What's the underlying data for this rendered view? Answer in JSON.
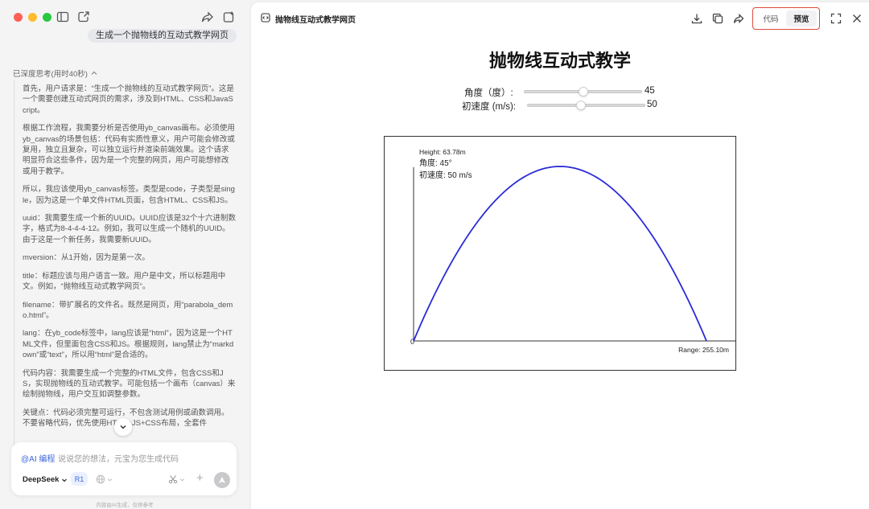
{
  "left_panel": {
    "window_controls": [
      "close",
      "minimize",
      "zoom"
    ],
    "colors": {
      "close": "#ff5f57",
      "minimize": "#febc2e",
      "zoom": "#28c840"
    },
    "toolbar_icons": [
      "sidebar-icon",
      "new-chat-icon",
      "share-icon",
      "new-window-icon"
    ],
    "user_message": "生成一个抛物线的互动式教学网页",
    "thinking_header": "已深度思考(用时40秒)",
    "thinking_paragraphs": [
      "首先，用户请求是：“生成一个抛物线的互动式教学网页”。这是一个需要创建互动式网页的需求，涉及到HTML、CSS和JavaScript。",
      "根据工作流程，我需要分析是否使用yb_canvas画布。必须使用yb_canvas的场景包括：代码有实质性意义，用户可能会修改或复用，独立且复杂，可以独立运行并渲染前端效果。这个请求明显符合这些条件，因为是一个完整的网页，用户可能想修改或用于教学。",
      "所以，我应该使用yb_canvas标签。类型是code，子类型是single，因为这是一个单文件HTML页面，包含HTML、CSS和JS。",
      "uuid：我需要生成一个新的UUID。UUID应该是32个十六进制数字，格式为8-4-4-4-12。例如，我可以生成一个随机的UUID。由于这是一个新任务，我需要新UUID。",
      "mversion：从1开始，因为是第一次。",
      "title：标题应该与用户语言一致。用户是中文，所以标题用中文。例如，“抛物线互动式教学网页”。",
      "filename：带扩展名的文件名。既然是网页，用“parabola_demo.html”。",
      "lang：在yb_code标签中，lang应该是“html”，因为这是一个HTML文件，但里面包含CSS和JS。根据规则，lang禁止为“markdown”或“text”，所以用“html”是合适的。",
      "代码内容：我需要生成一个完整的HTML文件，包含CSS和JS，实现抛物线的互动式教学。可能包括一个画布（canvas）来绘制抛物线，用户交互如调整参数。",
      "关键点：代码必须完整可运行，不包含测试用例或函数调用。不要省略代码，优先使用HTML+JS+CSS布局，全套件"
    ],
    "composer": {
      "tag": "@AI 编程",
      "placeholder": "说说您的想法，元宝为您生成代码",
      "model": "DeepSeek",
      "mode_badge": "R1"
    },
    "disclaimer": "内容由AI生成，仅供参考"
  },
  "right_panel": {
    "document_title": "抛物线互动式教学网页",
    "header_icons": [
      "download-icon",
      "copy-icon",
      "share-icon",
      "fullscreen-icon",
      "close-icon"
    ],
    "tabs": [
      {
        "label": "代码",
        "active": false
      },
      {
        "label": "预览",
        "active": true
      }
    ],
    "accent_color": "#e04a3b",
    "preview": {
      "heading": "抛物线互动式教学",
      "angle_label": "角度（度）:",
      "angle_value": "45",
      "angle_fraction": 0.5,
      "speed_label": "初速度 (m/s):",
      "speed_value": "50",
      "speed_fraction": 0.45,
      "canvas": {
        "height_text": "Height: 63.78m",
        "angle_text": "角度: 45°",
        "speed_text": "初速度: 50 m/s",
        "origin_text": "0",
        "range_text": "Range: 255.10m",
        "curve_color": "#2b2bd9"
      }
    }
  },
  "chart_data": {
    "type": "line",
    "title": "",
    "xlabel": "",
    "ylabel": "",
    "series": [
      {
        "x": [
          0,
          25.5,
          51.0,
          76.5,
          102.0,
          127.55,
          153.1,
          178.6,
          204.1,
          229.6,
          255.1
        ],
        "y": [
          0,
          22.96,
          40.82,
          53.57,
          61.22,
          63.78,
          61.22,
          53.57,
          40.82,
          22.96,
          0
        ]
      }
    ],
    "xlim": [
      0,
      255.1
    ],
    "ylim": [
      0,
      63.78
    ],
    "grid": false
  }
}
